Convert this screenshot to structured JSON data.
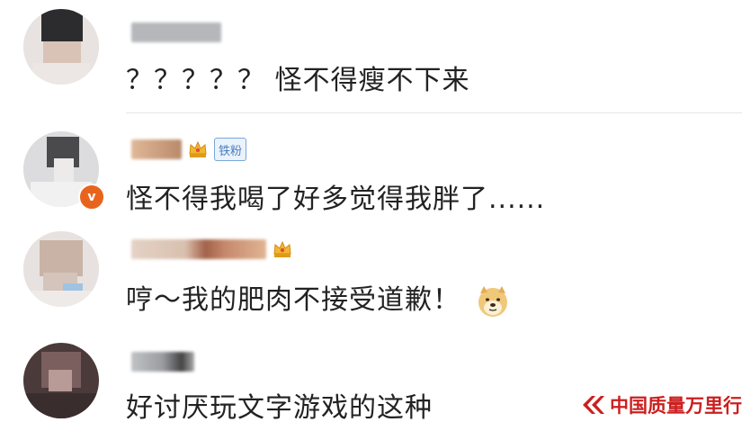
{
  "comments": [
    {
      "username": "",
      "text": "？？？？？ 怪不得瘦不下来"
    },
    {
      "username": "",
      "fan_badge": "铁粉",
      "verified": "v",
      "text": "怪不得我喝了好多觉得我胖了......"
    },
    {
      "username": "",
      "text": "哼～我的肥肉不接受道歉！"
    },
    {
      "username": "",
      "text": "好讨厌玩文字游戏的这种"
    }
  ],
  "icons": {
    "crown": "crown-icon",
    "emoji": "doge-emoji-icon",
    "verified": "verified-badge-icon"
  },
  "colors": {
    "verified": "#e8641d",
    "fan_badge": "#4a7fbf",
    "watermark": "#cc1f1f"
  },
  "watermark": {
    "text": "中国质量万里行"
  }
}
